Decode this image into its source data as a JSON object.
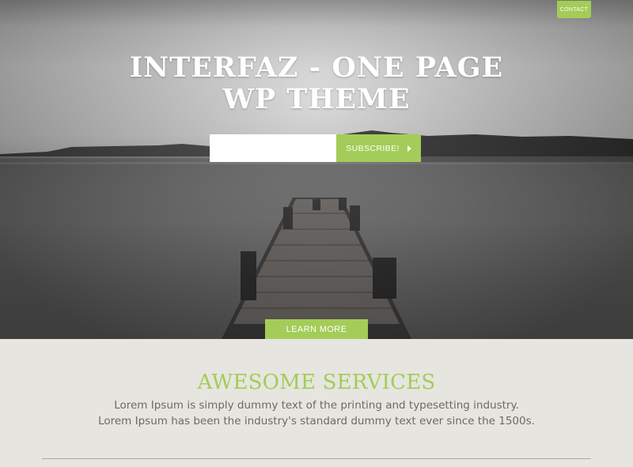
{
  "header": {
    "contact_label": "CONTACT"
  },
  "hero": {
    "title_line1": "INTERFAZ - ONE PAGE",
    "title_line2": "WP THEME",
    "subscribe_placeholder": "",
    "subscribe_label": "SUBSCRIBE!",
    "learn_more_label": "LEARN MORE"
  },
  "services": {
    "heading": "AWESOME SERVICES",
    "text_line1": "Lorem Ipsum is simply dummy text of the printing and typesetting industry.",
    "text_line2": "Lorem Ipsum has been the industry's standard dummy text ever since the 1500s."
  },
  "colors": {
    "accent": "#a3cc58",
    "section_bg": "#e6e5df",
    "body_text": "#6a6a6a"
  }
}
